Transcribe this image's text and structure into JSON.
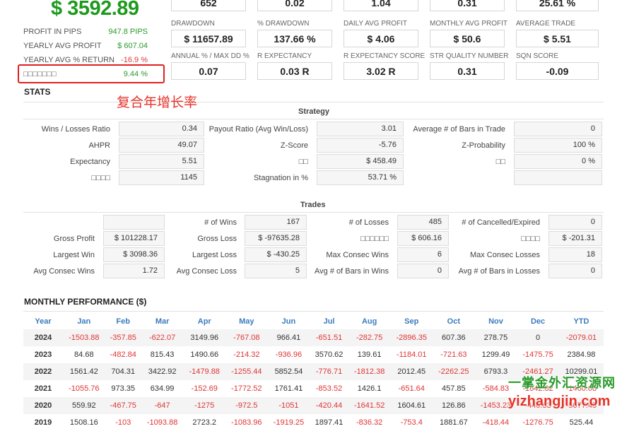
{
  "balance": "$ 3592.89",
  "left_stats": [
    {
      "label": "PROFIT IN PIPS",
      "value": "947.8 PIPS",
      "color": "green"
    },
    {
      "label": "YEARLY AVG PROFIT",
      "value": "$ 607.04",
      "color": "green"
    },
    {
      "label": "YEARLY AVG % RETURN",
      "value": "-16.9 %",
      "color": "red"
    },
    {
      "label": "□□□□□□□",
      "value": "9.44 %",
      "color": "green"
    }
  ],
  "top_values": [
    "652",
    "0.02",
    "1.04",
    "0.31",
    "25.61 %"
  ],
  "metrics_row1": [
    {
      "label": "DRAWDOWN",
      "value": "$ 11657.89"
    },
    {
      "label": "% DRAWDOWN",
      "value": "137.66 %"
    },
    {
      "label": "DAILY AVG PROFIT",
      "value": "$ 4.06"
    },
    {
      "label": "MONTHLY AVG PROFIT",
      "value": "$ 50.6"
    },
    {
      "label": "AVERAGE TRADE",
      "value": "$ 5.51"
    }
  ],
  "metrics_row2": [
    {
      "label": "ANNUAL % / MAX DD %",
      "value": "0.07"
    },
    {
      "label": "R EXPECTANCY",
      "value": "0.03 R"
    },
    {
      "label": "R EXPECTANCY SCORE",
      "value": "3.02 R"
    },
    {
      "label": "STR QUALITY NUMBER",
      "value": "0.31"
    },
    {
      "label": "SQN SCORE",
      "value": "-0.09"
    }
  ],
  "stats_heading": "STATS",
  "annotation": "复合年增长率",
  "strategy": {
    "title": "Strategy",
    "rows": [
      [
        {
          "label": "Wins / Losses Ratio",
          "value": "0.34"
        },
        {
          "label": "Payout Ratio (Avg Win/Loss)",
          "value": "3.01"
        },
        {
          "label": "Average # of Bars in Trade",
          "value": "0"
        }
      ],
      [
        {
          "label": "AHPR",
          "value": "49.07"
        },
        {
          "label": "Z-Score",
          "value": "-5.76"
        },
        {
          "label": "Z-Probability",
          "value": "100 %"
        }
      ],
      [
        {
          "label": "Expectancy",
          "value": "5.51"
        },
        {
          "label": "□□",
          "value": "$ 458.49"
        },
        {
          "label": "□□",
          "value": "0 %"
        }
      ],
      [
        {
          "label": "□□□□",
          "value": "1145"
        },
        {
          "label": "Stagnation in %",
          "value": "53.71 %"
        },
        {
          "label": "",
          "value": ""
        }
      ]
    ]
  },
  "trades": {
    "title": "Trades",
    "rows": [
      [
        {
          "label": "",
          "value": ""
        },
        {
          "label": "# of Wins",
          "value": "167"
        },
        {
          "label": "# of Losses",
          "value": "485"
        },
        {
          "label": "# of Cancelled/Expired",
          "value": "0"
        }
      ],
      [
        {
          "label": "Gross Profit",
          "value": "$ 101228.17"
        },
        {
          "label": "Gross Loss",
          "value": "$ -97635.28"
        },
        {
          "label": "□□□□□□",
          "value": "$ 606.16"
        },
        {
          "label": "□□□□",
          "value": "$ -201.31"
        }
      ],
      [
        {
          "label": "Largest Win",
          "value": "$ 3098.36"
        },
        {
          "label": "Largest Loss",
          "value": "$ -430.25"
        },
        {
          "label": "Max Consec Wins",
          "value": "6"
        },
        {
          "label": "Max Consec Losses",
          "value": "18"
        }
      ],
      [
        {
          "label": "Avg Consec Wins",
          "value": "1.72"
        },
        {
          "label": "Avg Consec Loss",
          "value": "5"
        },
        {
          "label": "Avg # of Bars in Wins",
          "value": "0"
        },
        {
          "label": "Avg # of Bars in Losses",
          "value": "0"
        }
      ]
    ]
  },
  "monthly": {
    "title": "MONTHLY PERFORMANCE ($)",
    "headers": [
      "Year",
      "Jan",
      "Feb",
      "Mar",
      "Apr",
      "May",
      "Jun",
      "Jul",
      "Aug",
      "Sep",
      "Oct",
      "Nov",
      "Dec",
      "YTD"
    ],
    "rows": [
      [
        "2024",
        "-1503.88",
        "-357.85",
        "-622.07",
        "3149.96",
        "-767.08",
        "966.41",
        "-651.51",
        "-282.75",
        "-2896.35",
        "607.36",
        "278.75",
        "0",
        "-2079.01"
      ],
      [
        "2023",
        "84.68",
        "-482.84",
        "815.43",
        "1490.66",
        "-214.32",
        "-936.96",
        "3570.62",
        "139.61",
        "-1184.01",
        "-721.63",
        "1299.49",
        "-1475.75",
        "2384.98"
      ],
      [
        "2022",
        "1561.42",
        "704.31",
        "3422.92",
        "-1479.88",
        "-1255.44",
        "5852.54",
        "-776.71",
        "-1812.38",
        "2012.45",
        "-2262.25",
        "6793.3",
        "-2461.27",
        "10299.01"
      ],
      [
        "2021",
        "-1055.76",
        "973.35",
        "634.99",
        "-152.69",
        "-1772.52",
        "1761.41",
        "-853.52",
        "1426.1",
        "-651.64",
        "457.85",
        "-584.83",
        "-1642.82",
        "-1460.08"
      ],
      [
        "2020",
        "559.92",
        "-467.75",
        "-647",
        "-1275",
        "-972.5",
        "-1051",
        "-420.44",
        "-1641.52",
        "1604.61",
        "126.86",
        "-1453.23",
        "-446.33",
        "-5077.45"
      ],
      [
        "2019",
        "1508.16",
        "-103",
        "-1093.88",
        "2723.2",
        "-1083.96",
        "-1919.25",
        "1897.41",
        "-836.32",
        "-753.4",
        "1881.67",
        "-418.44",
        "-1276.75",
        "525.44"
      ]
    ]
  },
  "watermark": {
    "line1": "一掌金外汇资源网",
    "line2": "yizhangjin.com"
  }
}
